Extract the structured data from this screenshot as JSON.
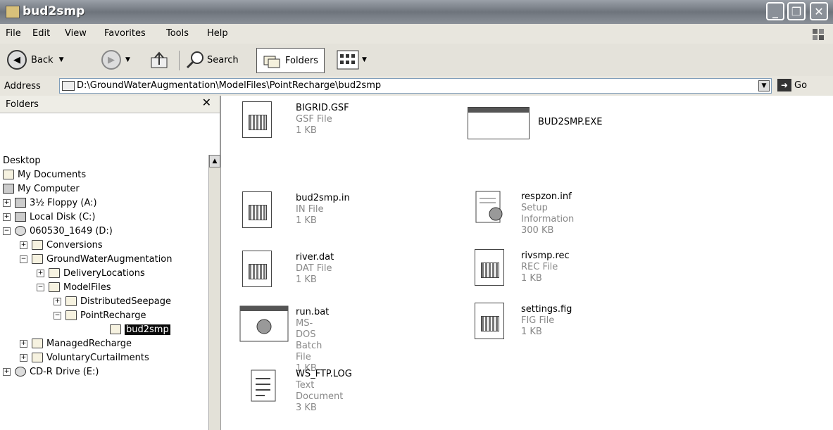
{
  "window": {
    "title": "bud2smp"
  },
  "menu": [
    "File",
    "Edit",
    "View",
    "Favorites",
    "Tools",
    "Help"
  ],
  "toolbar": {
    "back_label": "Back",
    "search_label": "Search",
    "folders_label": "Folders"
  },
  "address": {
    "label": "Address",
    "path": "D:\\GroundWaterAugmentation\\ModelFiles\\PointRecharge\\bud2smp",
    "go_label": "Go"
  },
  "folders_pane": {
    "title": "Folders",
    "items": [
      {
        "label": "Desktop"
      },
      {
        "label": "My Documents"
      },
      {
        "label": "My Computer"
      },
      {
        "label": "3½ Floppy (A:)"
      },
      {
        "label": "Local Disk (C:)"
      },
      {
        "label": "060530_1649 (D:)"
      },
      {
        "label": "Conversions"
      },
      {
        "label": "GroundWaterAugmentation"
      },
      {
        "label": "DeliveryLocations"
      },
      {
        "label": "ModelFiles"
      },
      {
        "label": "DistributedSeepage"
      },
      {
        "label": "PointRecharge"
      },
      {
        "label": "bud2smp"
      },
      {
        "label": "ManagedRecharge"
      },
      {
        "label": "VoluntaryCurtailments"
      },
      {
        "label": "CD-R Drive (E:)"
      }
    ]
  },
  "files": [
    {
      "name": "BIGRID.GSF",
      "type": "GSF File",
      "size": "1 KB"
    },
    {
      "name": "BUD2SMP.EXE",
      "type": "",
      "size": ""
    },
    {
      "name": "bud2smp.in",
      "type": "IN File",
      "size": "1 KB"
    },
    {
      "name": "respzon.inf",
      "type": "Setup Information",
      "size": "300 KB"
    },
    {
      "name": "river.dat",
      "type": "DAT File",
      "size": "1 KB"
    },
    {
      "name": "rivsmp.rec",
      "type": "REC File",
      "size": "1 KB"
    },
    {
      "name": "run.bat",
      "type": "MS-DOS Batch File",
      "size": "1 KB"
    },
    {
      "name": "settings.fig",
      "type": "FIG File",
      "size": "1 KB"
    },
    {
      "name": "WS_FTP.LOG",
      "type": "Text Document",
      "size": "3 KB"
    }
  ]
}
